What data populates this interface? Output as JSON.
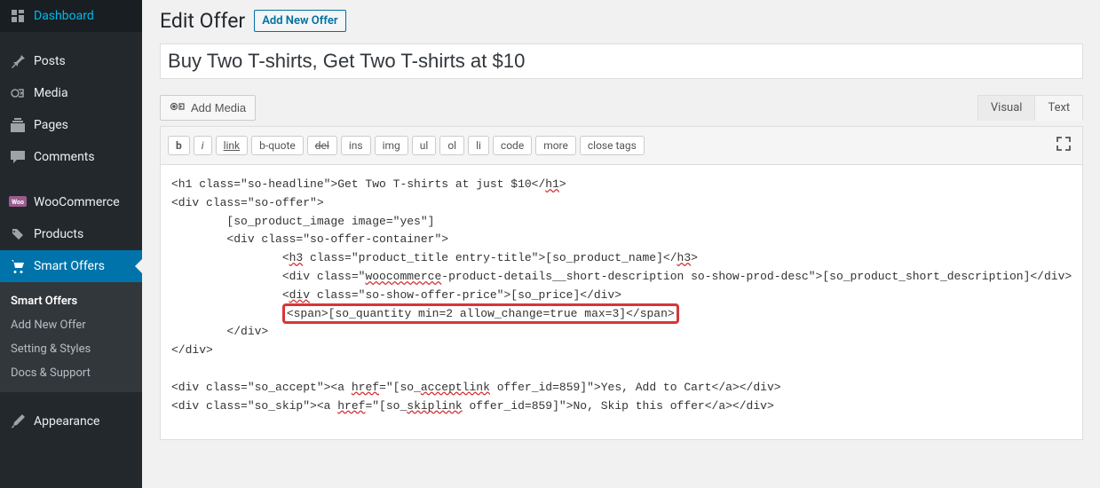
{
  "sidebar": {
    "items": [
      {
        "label": "Dashboard",
        "icon": "dashboard"
      },
      {
        "label": "Posts",
        "icon": "pin"
      },
      {
        "label": "Media",
        "icon": "media"
      },
      {
        "label": "Pages",
        "icon": "pages"
      },
      {
        "label": "Comments",
        "icon": "comments"
      },
      {
        "label": "WooCommerce",
        "icon": "woo"
      },
      {
        "label": "Products",
        "icon": "products"
      },
      {
        "label": "Smart Offers",
        "icon": "cart"
      },
      {
        "label": "Appearance",
        "icon": "brush"
      }
    ],
    "submenu": [
      {
        "label": "Smart Offers"
      },
      {
        "label": "Add New Offer"
      },
      {
        "label": "Setting & Styles"
      },
      {
        "label": "Docs & Support"
      }
    ]
  },
  "page": {
    "title": "Edit Offer",
    "add_new_label": "Add New Offer"
  },
  "post": {
    "title_value": "Buy Two T-shirts, Get Two T-shirts at $10"
  },
  "editor": {
    "add_media_label": "Add Media",
    "tabs": {
      "visual": "Visual",
      "text": "Text"
    },
    "quicktags": {
      "b": "b",
      "i": "i",
      "link": "link",
      "bquote": "b-quote",
      "del": "del",
      "ins": "ins",
      "img": "img",
      "ul": "ul",
      "ol": "ol",
      "li": "li",
      "code": "code",
      "more": "more",
      "close": "close tags"
    },
    "code_lines": {
      "l1a": "<h1 class=\"so-headline\">Get Two T-shirts at just $10</",
      "l1b": "h1",
      "l1c": ">",
      "l2": "<div class=\"so-offer\">",
      "l3": "        [so_product_image image=\"yes\"]",
      "l4": "        <div class=\"so-offer-container\">",
      "l5a": "                <",
      "l5b": "h3",
      "l5c": " class=\"product_title entry-title\">[so_product_name]</",
      "l5d": "h3",
      "l5e": ">",
      "l6a": "                <div class=\"",
      "l6b": "woocommerce",
      "l6c": "-product-details__short-description so-show-prod-desc\">[so_product_short_description]</div>",
      "l7a": "                <",
      "l7b": "div",
      "l7c": " class=\"so-show-offer-price\">[so_price]</div>",
      "l8": "<span>[so_quantity min=2 allow_change=true max=3]</span>",
      "l9": "        </div>",
      "l10": "</div>",
      "l11": "",
      "l12a": "<div class=\"so_accept\"><a ",
      "l12b": "href",
      "l12c": "=\"[so_",
      "l12d": "acceptlink",
      "l12e": " offer_id=859]\">Yes, Add to Cart</a></div>",
      "l13a": "<div class=\"so_skip\"><a ",
      "l13b": "href",
      "l13c": "=\"[so_",
      "l13d": "skiplink",
      "l13e": " offer_id=859]\">No, Skip this offer</a></div>"
    }
  }
}
